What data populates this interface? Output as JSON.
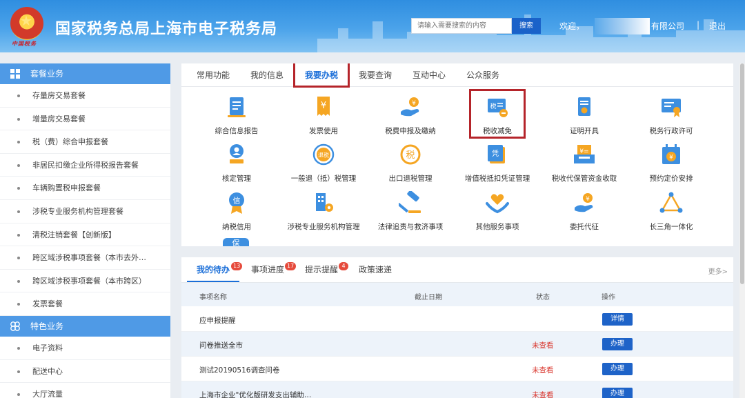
{
  "header": {
    "title": "国家税务总局上海市电子税务局",
    "emblem_sub": "中国税务",
    "search_placeholder": "请输入需要搜索的内容",
    "search_button": "搜索",
    "welcome": "欢迎，",
    "company": "有限公司",
    "separator": "|",
    "logout": "退出"
  },
  "sidebar": {
    "groups": [
      {
        "label": "套餐业务",
        "icon": "grid-icon",
        "items": [
          "存量房交易套餐",
          "增量房交易套餐",
          "税（费）综合申报套餐",
          "非居民扣缴企业所得税报告套餐",
          "车辆购置税申报套餐",
          "涉税专业服务机构管理套餐",
          "清税注销套餐【创新版】",
          "跨区域涉税事项套餐（本市去外…",
          "跨区域涉税事项套餐（本市跨区）",
          "发票套餐"
        ]
      },
      {
        "label": "特色业务",
        "icon": "flower-icon",
        "items": [
          "电子资料",
          "配送中心",
          "大厅流量"
        ]
      }
    ]
  },
  "services": {
    "tabs": [
      "常用功能",
      "我的信息",
      "我要办税",
      "我要查询",
      "互动中心",
      "公众服务"
    ],
    "active_tab": "我要办税",
    "items": [
      {
        "label": "综合信息报告",
        "icon": "report-icon"
      },
      {
        "label": "发票使用",
        "icon": "invoice-icon"
      },
      {
        "label": "税费申报及缴纳",
        "icon": "coin-hand-icon"
      },
      {
        "label": "税收减免",
        "icon": "tax-reduction-icon"
      },
      {
        "label": "证明开具",
        "icon": "certificate-icon"
      },
      {
        "label": "税务行政许可",
        "icon": "license-icon"
      },
      {
        "label": "核定管理",
        "icon": "stamp-icon"
      },
      {
        "label": "一般退（抵）税管理",
        "icon": "refund-icon"
      },
      {
        "label": "出口退税管理",
        "icon": "export-refund-icon"
      },
      {
        "label": "增值税抵扣凭证管理",
        "icon": "voucher-icon"
      },
      {
        "label": "税收代保管资金收取",
        "icon": "yen-tray-icon"
      },
      {
        "label": "预约定价安排",
        "icon": "calendar-icon"
      },
      {
        "label": "纳税信用",
        "icon": "credit-medal-icon"
      },
      {
        "label": "涉税专业服务机构管理",
        "icon": "building-gear-icon"
      },
      {
        "label": "法律追责与救济事项",
        "icon": "gavel-icon"
      },
      {
        "label": "其他服务事项",
        "icon": "heart-hands-icon"
      },
      {
        "label": "委托代征",
        "icon": "coin-hand-icon"
      },
      {
        "label": "长三角一体化",
        "icon": "triangle-network-icon"
      }
    ],
    "partial_label": "保"
  },
  "todo": {
    "tabs": [
      {
        "label": "我的待办",
        "badge": "13"
      },
      {
        "label": "事项进度",
        "badge": "17"
      },
      {
        "label": "提示提醒",
        "badge": "4"
      },
      {
        "label": "政策速递",
        "badge": ""
      }
    ],
    "more": "更多>",
    "columns": [
      "事项名称",
      "截止日期",
      "状态",
      "操作"
    ],
    "rows": [
      {
        "name": "应申报提醒",
        "status": "",
        "action": "详情"
      },
      {
        "name": "问卷推送全市",
        "status": "未查看",
        "action": "办理"
      },
      {
        "name": "测试20190516调查问卷",
        "status": "未查看",
        "action": "办理"
      },
      {
        "name": "上海市企业\"优化版研发支出辅助…",
        "status": "未查看",
        "action": "办理"
      }
    ]
  },
  "colors": {
    "header_blue": "#2f8ee0",
    "sidebar_group_blue": "#4f9ae6",
    "accent_blue": "#1a6ed8",
    "icon_orange": "#f5a623",
    "icon_blue": "#3d8fe0",
    "highlight_red": "#b5242a",
    "status_red": "#d9342b"
  }
}
